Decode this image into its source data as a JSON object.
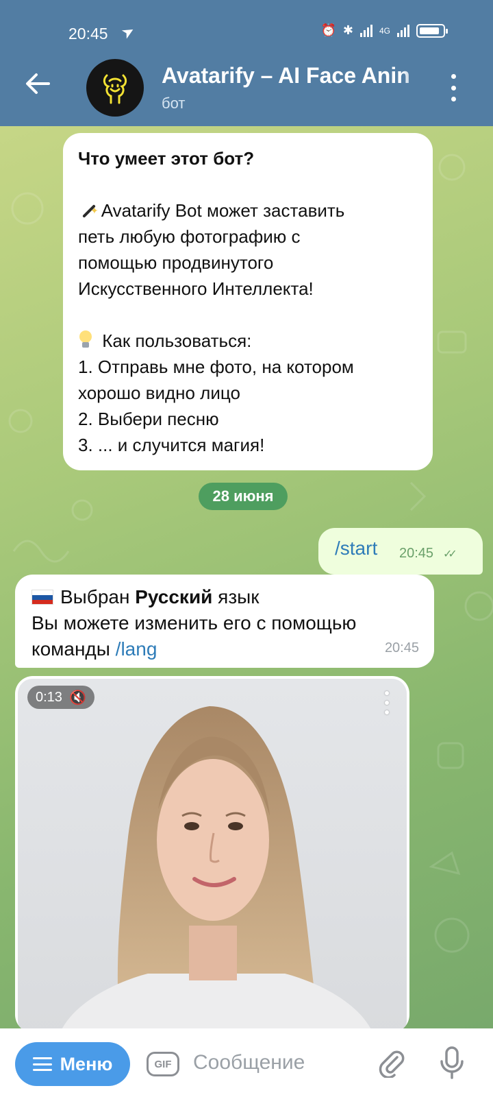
{
  "status_bar": {
    "time": "20:45",
    "network": "4G"
  },
  "header": {
    "title": "Avatarify – AI Face Anin",
    "subtitle": "бот"
  },
  "about_message": {
    "title": "Что умеет этот бот?",
    "line1": "Avatarify Bot может заставить",
    "line2": "петь любую фотографию с",
    "line3": "помощью продвинутого",
    "line4": "Искусственного Интеллекта!",
    "howto": "Как пользоваться:",
    "step1a": "1. Отправь мне фото, на котором",
    "step1b": "хорошо видно лицо",
    "step2": "2. Выбери песню",
    "step3": "3. ... и случится магия!"
  },
  "date_chip": "28 июня",
  "outgoing": {
    "text": "/start",
    "time": "20:45"
  },
  "lang_message": {
    "prefix": "Выбран",
    "language": "Русский",
    "suffix": "язык",
    "line2": "Вы можете изменить его с помощью",
    "line3_prefix": "команды",
    "command": "/lang",
    "time": "20:45"
  },
  "video": {
    "duration": "0:13"
  },
  "composer": {
    "menu_label": "Меню",
    "gif_label": "GIF",
    "placeholder": "Сообщение"
  },
  "colors": {
    "header": "#527da3",
    "accent": "#4a9be8",
    "link": "#2e7cb8",
    "date_chip": "#4e9e5f",
    "outgoing_bubble": "#effedd"
  }
}
